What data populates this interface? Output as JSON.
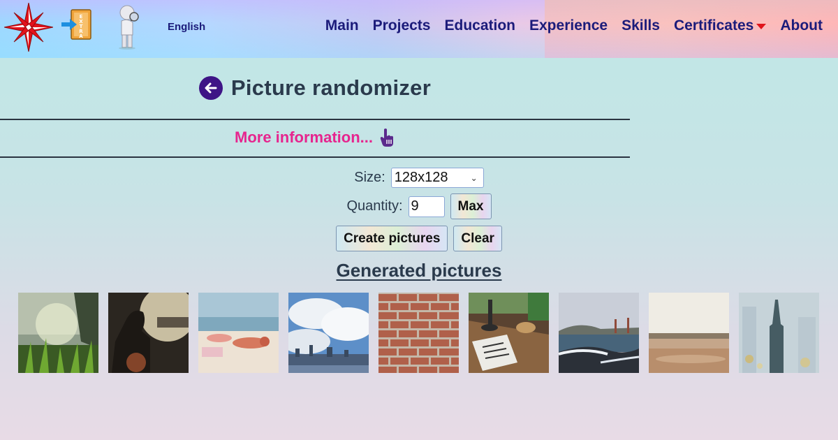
{
  "header": {
    "language": "English",
    "nav": [
      {
        "label": "Main"
      },
      {
        "label": "Projects"
      },
      {
        "label": "Education"
      },
      {
        "label": "Experience"
      },
      {
        "label": "Skills"
      },
      {
        "label": "Certificates"
      },
      {
        "label": "About"
      }
    ],
    "extra_icon_text": "EXTRA",
    "icons": [
      "compass-logo-icon",
      "extra-exit-icon",
      "search-person-icon",
      "dropdown-caret-icon"
    ]
  },
  "main": {
    "title": "Picture randomizer",
    "more_info": "More information...",
    "size_label": "Size:",
    "size_value": "128x128",
    "quantity_label": "Quantity:",
    "quantity_value": "9",
    "max_label": "Max",
    "create_label": "Create pictures",
    "clear_label": "Clear",
    "generated_title": "Generated pictures"
  },
  "colors": {
    "nav_text": "#1b1b7a",
    "title_text": "#2a3a4c",
    "accent_pink": "#e6258e",
    "back_button": "#3e1486",
    "caret_red": "#e0141b"
  },
  "gallery": [
    {
      "subject": "grass-field"
    },
    {
      "subject": "person-silhouette-sunset"
    },
    {
      "subject": "beach-sunbather"
    },
    {
      "subject": "city-skyline-clouds"
    },
    {
      "subject": "brick-wall"
    },
    {
      "subject": "desk-notebook-coffee"
    },
    {
      "subject": "golden-gate-beach"
    },
    {
      "subject": "sandy-shore"
    },
    {
      "subject": "city-tower-blur"
    }
  ]
}
